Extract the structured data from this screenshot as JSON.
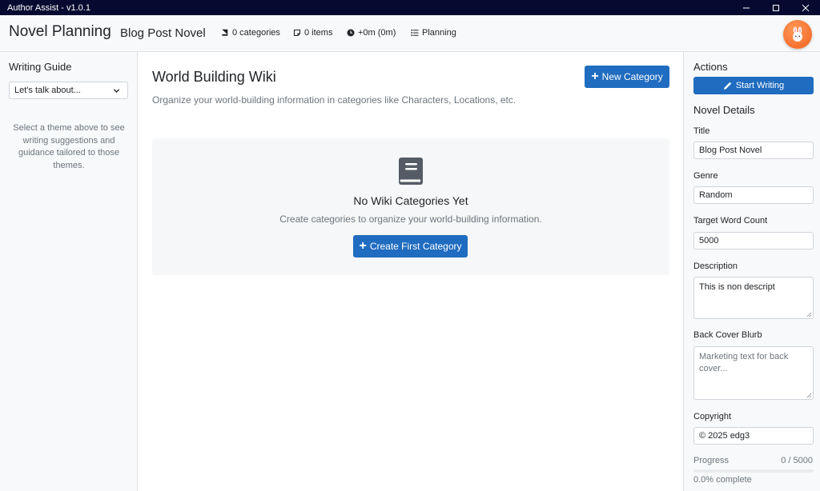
{
  "app": {
    "title": "Author Assist - v1.0.1"
  },
  "header": {
    "title": "Novel Planning",
    "novel_name": "Blog Post Novel",
    "categories": "0 categories",
    "items": "0 items",
    "time": "+0m (0m)",
    "status": "Planning"
  },
  "left_sidebar": {
    "heading": "Writing Guide",
    "select_value": "Let's talk about...",
    "help_text": "Select a theme above to see writing suggestions and guidance tailored to those themes."
  },
  "main": {
    "title": "World Building Wiki",
    "subtitle": "Organize your world-building information in categories like Characters, Locations, etc.",
    "new_category_label": "New Category",
    "empty_title": "No Wiki Categories Yet",
    "empty_subtitle": "Create categories to organize your world-building information.",
    "create_first_label": "Create First Category"
  },
  "right_sidebar": {
    "actions_heading": "Actions",
    "start_writing_label": "Start Writing",
    "details_heading": "Novel Details",
    "fields": {
      "title_label": "Title",
      "title_value": "Blog Post Novel",
      "genre_label": "Genre",
      "genre_value": "Random",
      "target_label": "Target Word Count",
      "target_value": "5000",
      "description_label": "Description",
      "description_value": "This is non descript",
      "blurb_label": "Back Cover Blurb",
      "blurb_placeholder": "Marketing text for back cover...",
      "copyright_label": "Copyright",
      "copyright_value": "© 2025 edg3"
    },
    "progress": {
      "label": "Progress",
      "count": "0 / 5000",
      "percent_text": "0.0% complete",
      "fraction": 0.0
    }
  },
  "colors": {
    "titlebar": "#060a30",
    "primary": "#1f6cc0",
    "avatar": "#f25f1c"
  }
}
